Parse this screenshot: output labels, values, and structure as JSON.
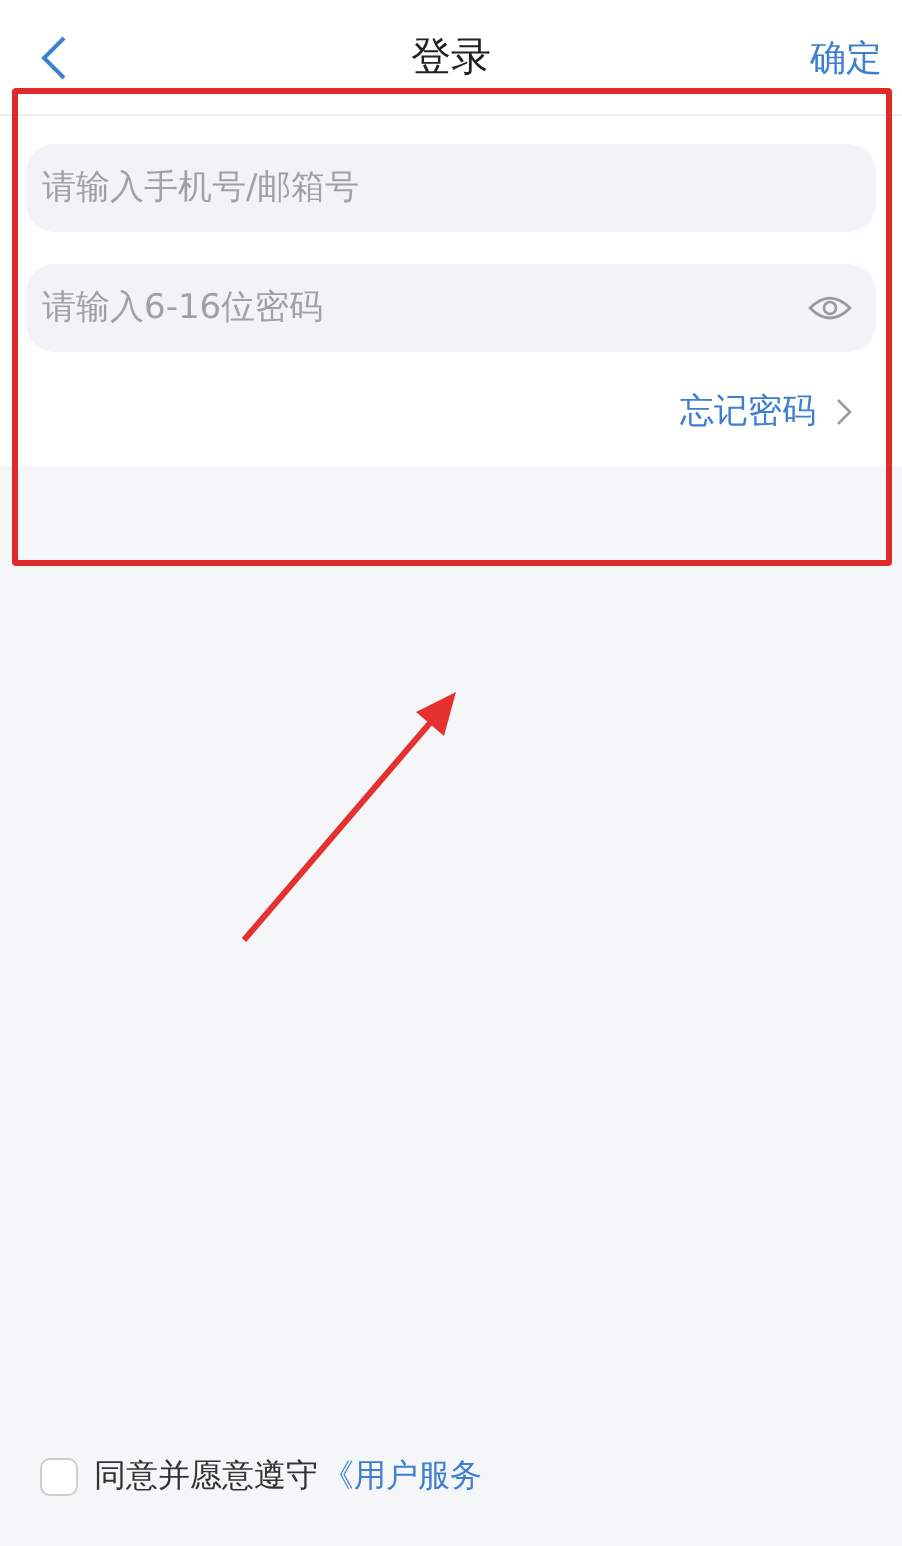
{
  "header": {
    "title": "登录",
    "confirm": "确定"
  },
  "fields": [
    {
      "kind": "account",
      "placeholder": "请输入手机号/邮箱号"
    },
    {
      "kind": "password",
      "placeholder": "请输入6-16位密码"
    }
  ],
  "forgot": "忘记密码",
  "agreement": {
    "checked": false,
    "text": "同意并愿意遵守",
    "link": "《用户服务"
  }
}
